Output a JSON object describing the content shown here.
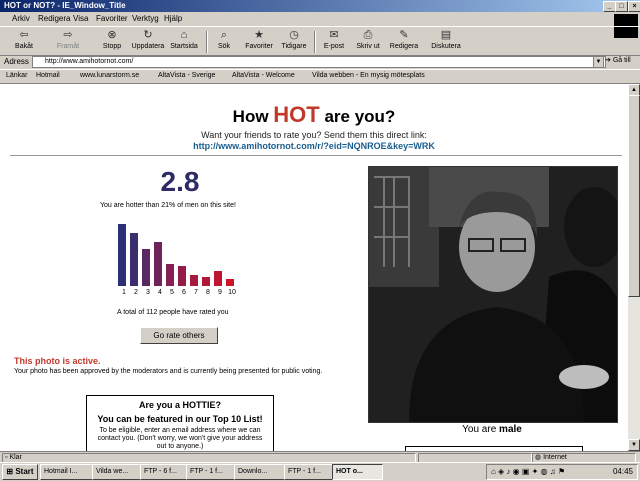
{
  "window": {
    "title": "HOT or NOT? - IE_Window_Title"
  },
  "menu": [
    "Arkiv",
    "Redigera",
    "Visa",
    "Favoriter",
    "Verktyg",
    "Hjälp"
  ],
  "toolbar": {
    "back": "Bakåt",
    "forward": "Framåt",
    "stop": "Stopp",
    "refresh": "Uppdatera",
    "home": "Startsida",
    "search": "Sök",
    "favorites": "Favoriter",
    "history": "Tidigare",
    "mail": "E-post",
    "print": "Skriv ut",
    "edit": "Redigera",
    "discuss": "Diskutera"
  },
  "address": {
    "label": "Adress",
    "url": "http://www.amihotornot.com/",
    "go": "Gå till"
  },
  "links": {
    "label": "Länkar",
    "items": [
      "Hotmail",
      "www.lunarstorm.se",
      "AltaVista - Sverige",
      "AltaVista - Welcome",
      "Vilda webben - En mysig mötesplats"
    ]
  },
  "page": {
    "heading_pre": "How ",
    "heading_hot": "HOT",
    "heading_post": " are you?",
    "subtitle": "Want your friends to rate you? Send them this direct link:",
    "link": "http://www.amihotornot.com/r/?eid=NQNROE&key=WRK",
    "score": "2.8",
    "hotter_text": "You are hotter than 21% of men on this site!",
    "total_text": "A total of 112 people have rated you",
    "rate_button": "Go rate others",
    "active_title": "This photo is active.",
    "active_desc": "Your photo has been approved by the moderators and is currently being presented for public voting.",
    "hottie_title_1": "Are you a HOTTIE?",
    "hottie_title_2": "You can be featured in our Top 10 List!",
    "hottie_desc": "To be eligible, enter an email address where we can contact you. (Don't worry, we won't give your address out to anyone.)",
    "caption_pre": "You are ",
    "caption_gender": "male"
  },
  "chart_data": {
    "type": "bar",
    "categories": [
      "1",
      "2",
      "3",
      "4",
      "5",
      "6",
      "7",
      "8",
      "9",
      "10"
    ],
    "values": [
      28,
      24,
      17,
      20,
      10,
      9,
      5,
      4,
      7,
      3
    ],
    "colors": [
      "#2b2f73",
      "#3a2e6e",
      "#5a2860",
      "#6e2458",
      "#852050",
      "#931d48",
      "#a51a40",
      "#b01838",
      "#c01530",
      "#d01228"
    ],
    "ylim": [
      0,
      30
    ]
  },
  "status": {
    "text": "Klar",
    "zone": "Internet"
  },
  "taskbar": {
    "start": "Start",
    "buttons": [
      "Hotmail I...",
      "Vilda we...",
      "FTP - 6 f...",
      "FTP - 1 f...",
      "Downlo...",
      "FTP - 1 f...",
      "HOT o..."
    ],
    "clock": "04:45"
  }
}
